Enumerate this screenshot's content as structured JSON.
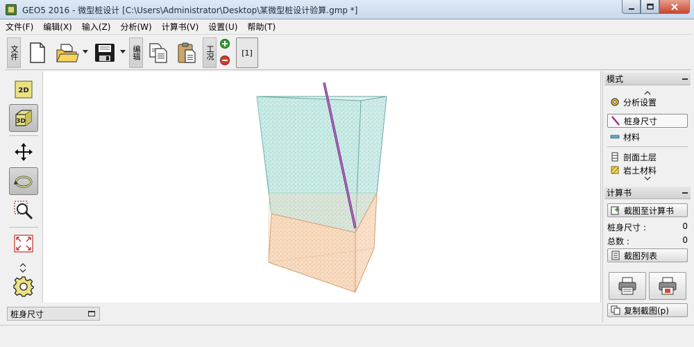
{
  "window": {
    "title": "GEO5 2016 - 微型桩设计 [C:\\Users\\Administrator\\Desktop\\某微型桩设计验算.gmp *]"
  },
  "menu": [
    "文件(F)",
    "编辑(X)",
    "输入(Z)",
    "分析(W)",
    "计算书(V)",
    "设置(U)",
    "帮助(T)"
  ],
  "toolbar": {
    "file_label": "文件",
    "edit_label": "编辑",
    "stage_label": "工况",
    "stage_value": "[1]"
  },
  "colors": {
    "upper_layer": "#bfe3dc",
    "lower_layer": "#f6d6b8",
    "pile": "#8a3a9a"
  },
  "bottom_tab": {
    "label": "桩身尺寸"
  },
  "right_panel": {
    "mode_header": "模式",
    "mode_items": [
      "分析设置",
      "桩身尺寸",
      "材料",
      "剖面土层",
      "岩土材料"
    ],
    "report_header": "计算书",
    "capture_button": "截图至计算书",
    "pile_size_label": "桩身尺寸 :",
    "pile_size_value": "0",
    "total_label": "总数 :",
    "total_value": "0",
    "list_button": "截图列表",
    "copy_button": "复制截图(p)"
  },
  "icons": {
    "new": "new-file-icon",
    "open": "open-folder-icon",
    "save": "save-icon",
    "copy": "copy-icon",
    "paste": "paste-icon",
    "add": "add-stage-icon",
    "remove": "remove-stage-icon",
    "view2d": "view-2d-icon",
    "view3d": "view-3d-icon",
    "move": "move-icon",
    "rotate": "rotate-icon",
    "zoom": "zoom-icon",
    "fit": "fit-view-icon",
    "settings": "gear-icon",
    "print": "printer-icon",
    "print_preview": "print-preview-icon"
  }
}
